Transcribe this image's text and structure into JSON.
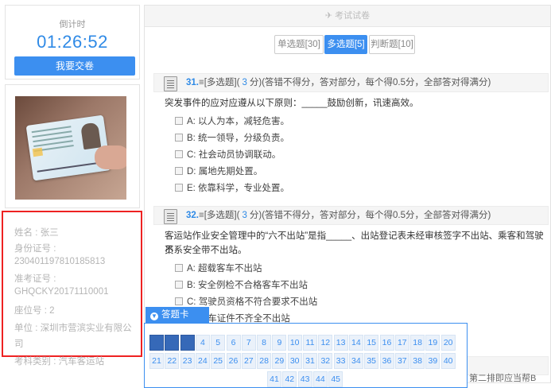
{
  "timer": {
    "label": "倒计时",
    "value": "01:26:52",
    "submit_label": "我要交卷"
  },
  "candidate": {
    "name": "姓名 : 张三",
    "id_label": "身份证号 :",
    "id_value": "230401197810185813",
    "ticket_label": "准考证号 :",
    "ticket_value": "GHQCKY20171110001",
    "seat": "座位号 : 2",
    "unit": "单位 : 深圳市营滨实业有限公司",
    "category": "考科类别 : 汽车客运站"
  },
  "header": {
    "title": "✈ 考试试卷"
  },
  "tabs": [
    {
      "label": "单选题[30]",
      "active": false
    },
    {
      "label": "多选题[5]",
      "active": true
    },
    {
      "label": "判断题[10]",
      "active": false
    }
  ],
  "questions": [
    {
      "number": "31.",
      "type": "[多选题](",
      "score": "3",
      "rule": "分)(答错不得分，答对部分，每个得0.5分，全部答对得满分)",
      "stem": "突发事件的应对应遵从以下原则：_____鼓励创新，讯速高效。",
      "options": [
        "A: 以人为本，减轻危害。",
        "B: 统一领导，分级负责。",
        "C: 社会动员协调联动。",
        "D: 属地先期处置。",
        "E: 依靠科学，专业处置。"
      ]
    },
    {
      "number": "32.",
      "type": "[多选题](",
      "score": "3",
      "rule": "分)(答错不得分，答对部分，每个得0.5分，全部答对得满分)",
      "stem_line1": "客运站作业安全管理中的“六不出站”是指_____、出站登记表未经审核签字不出站、乘客和驾驶员",
      "stem_line2": "不系安全带不出站。",
      "options": [
        "A: 超载客车不出站",
        "B: 安全例检不合格客车不出站",
        "C: 驾驶员资格不符合要求不出站",
        "D: 客车证件不齐全不出站"
      ]
    }
  ],
  "answer_card": {
    "label": "答题卡",
    "answered": [
      1,
      2,
      3
    ],
    "numbers": [
      "1",
      "2",
      "3",
      "4",
      "5",
      "6",
      "7",
      "8",
      "9",
      "10",
      "11",
      "12",
      "13",
      "14",
      "15",
      "16",
      "17",
      "18",
      "19",
      "20",
      "21",
      "22",
      "23",
      "24",
      "25",
      "26",
      "27",
      "28",
      "29",
      "30",
      "31",
      "32",
      "33",
      "34",
      "35",
      "36",
      "37",
      "38",
      "39",
      "40",
      "41",
      "42",
      "43",
      "44",
      "45"
    ]
  },
  "partial_text": "第二排即应当帮B",
  "colors": {
    "accent": "#3c8ff0",
    "highlight_border": "#e22222"
  }
}
